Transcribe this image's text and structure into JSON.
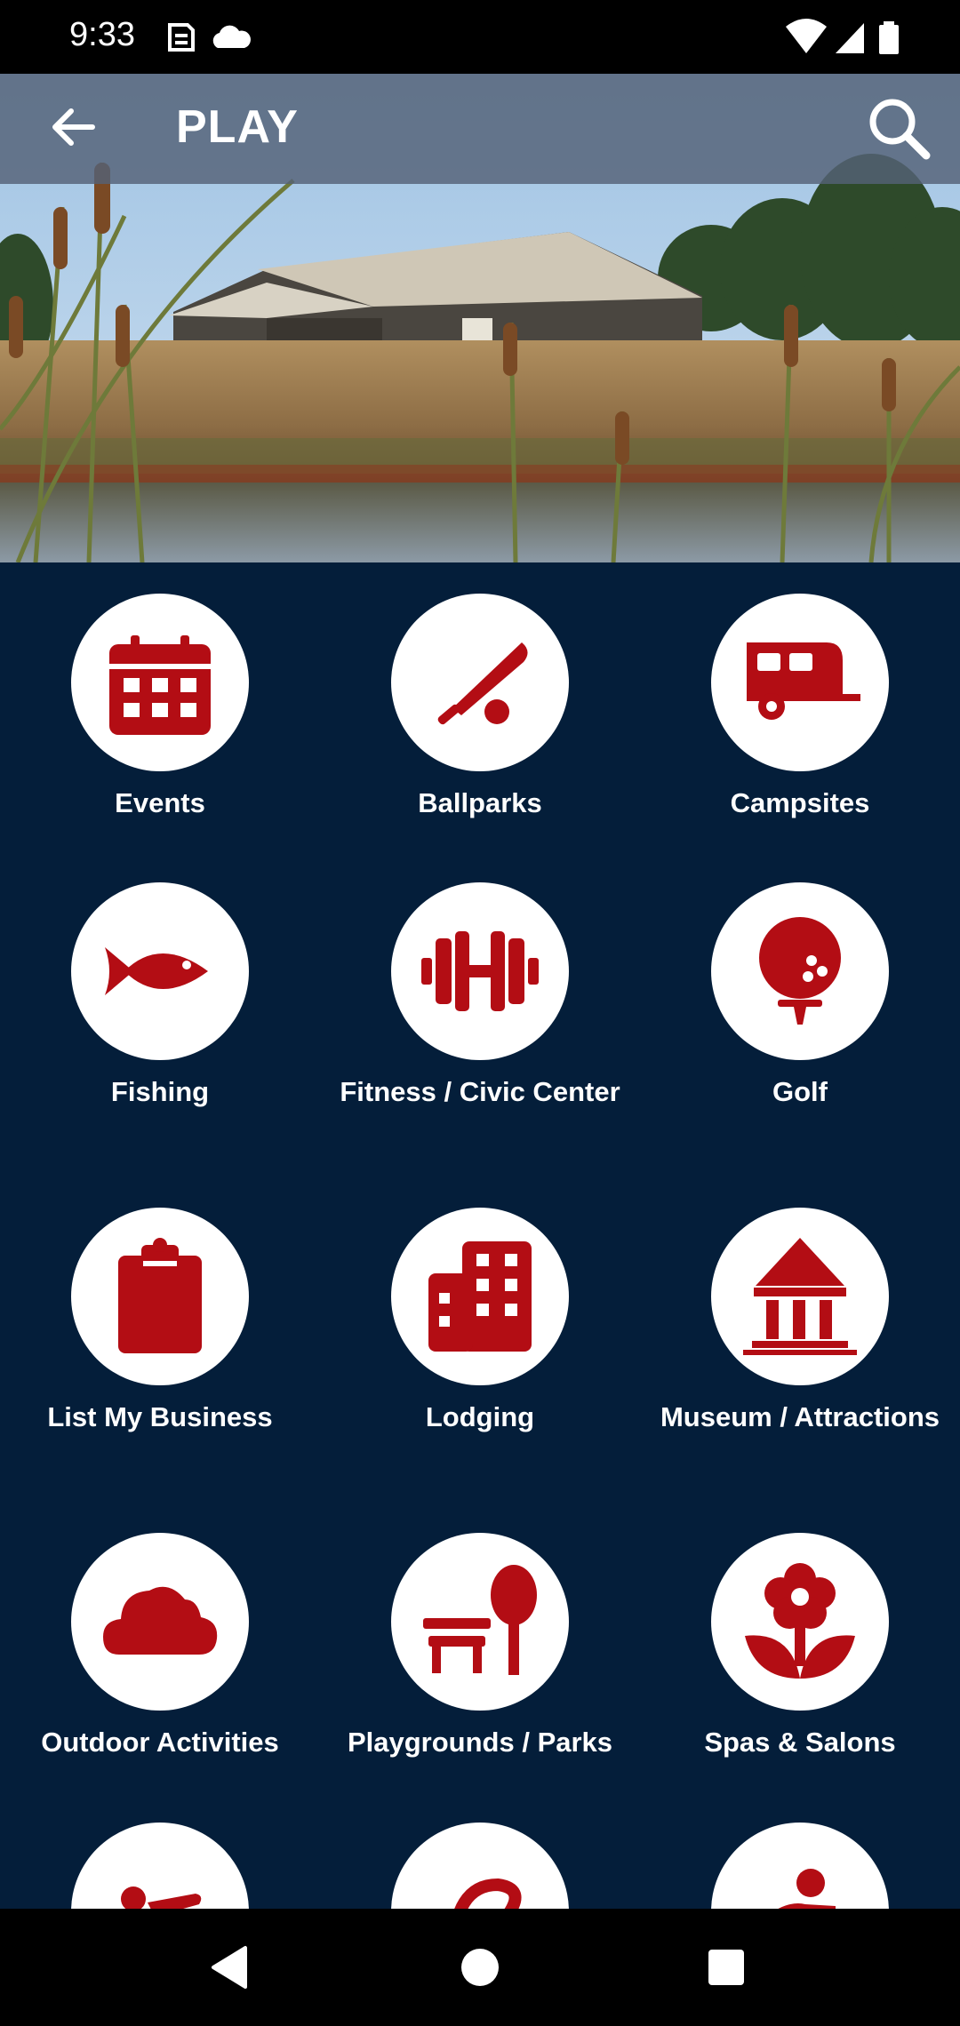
{
  "status_bar": {
    "time": "9:33",
    "left_icons": [
      "sim-icon",
      "cloud-icon"
    ],
    "right_icons": [
      "wifi-icon",
      "signal-icon",
      "battery-icon"
    ]
  },
  "app_bar": {
    "title": "PLAY",
    "back_icon": "arrow-left-icon",
    "search_icon": "search-icon"
  },
  "colors": {
    "background": "#041e3a",
    "icon_red": "#b30d14",
    "circle": "#ffffff"
  },
  "categories": [
    {
      "label": "Events",
      "icon": "calendar-icon"
    },
    {
      "label": "Ballparks",
      "icon": "baseball-bat-icon"
    },
    {
      "label": "Campsites",
      "icon": "camper-icon"
    },
    {
      "label": "Fishing",
      "icon": "fish-icon"
    },
    {
      "label": "Fitness / Civic Center",
      "icon": "dumbbell-icon"
    },
    {
      "label": "Golf",
      "icon": "golf-ball-icon"
    },
    {
      "label": "List My Business",
      "icon": "clipboard-icon"
    },
    {
      "label": "Lodging",
      "icon": "building-icon"
    },
    {
      "label": "Museum / Attractions",
      "icon": "museum-icon"
    },
    {
      "label": "Outdoor Activities",
      "icon": "cloud-icon"
    },
    {
      "label": "Playgrounds / Parks",
      "icon": "park-bench-icon"
    },
    {
      "label": "Spas & Salons",
      "icon": "flower-icon"
    },
    {
      "label": "",
      "icon": "swimmer-icon"
    },
    {
      "label": "",
      "icon": "ribbon-icon"
    },
    {
      "label": "",
      "icon": "person-icon"
    }
  ],
  "nav_bar": {
    "back": "nav-back-icon",
    "home": "nav-home-icon",
    "recents": "nav-recents-icon"
  }
}
